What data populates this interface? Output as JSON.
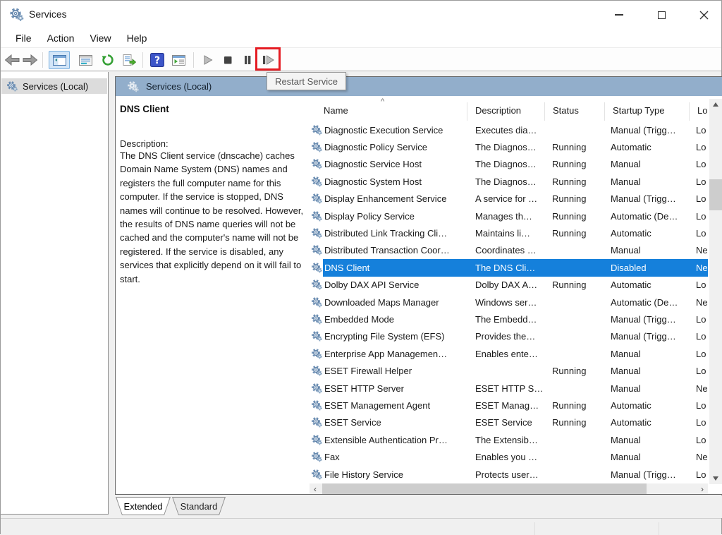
{
  "window": {
    "title": "Services"
  },
  "menu_bar": {
    "items": [
      "File",
      "Action",
      "View",
      "Help"
    ]
  },
  "toolbar": {
    "tooltip": "Restart Service"
  },
  "tree": {
    "root_label": "Services (Local)"
  },
  "band": {
    "title": "Services (Local)"
  },
  "description_pane": {
    "service_name": "DNS Client",
    "label": "Description:",
    "text": "The DNS Client service (dnscache) caches Domain Name System (DNS) names and registers the full computer name for this computer. If the service is stopped, DNS names will continue to be resolved. However, the results of DNS name queries will not be cached and the computer's name will not be registered. If the service is disabled, any services that explicitly depend on it will fail to start."
  },
  "services_table": {
    "columns": [
      "Name",
      "Description",
      "Status",
      "Startup Type",
      "Lo"
    ],
    "rows": [
      {
        "name": "Diagnostic Execution Service",
        "description": "Executes dia…",
        "status": "",
        "startup": "Manual (Trigg…",
        "logon": "Lo",
        "selected": false
      },
      {
        "name": "Diagnostic Policy Service",
        "description": "The Diagnos…",
        "status": "Running",
        "startup": "Automatic",
        "logon": "Lo",
        "selected": false
      },
      {
        "name": "Diagnostic Service Host",
        "description": "The Diagnos…",
        "status": "Running",
        "startup": "Manual",
        "logon": "Lo",
        "selected": false
      },
      {
        "name": "Diagnostic System Host",
        "description": "The Diagnos…",
        "status": "Running",
        "startup": "Manual",
        "logon": "Lo",
        "selected": false
      },
      {
        "name": "Display Enhancement Service",
        "description": "A service for …",
        "status": "Running",
        "startup": "Manual (Trigg…",
        "logon": "Lo",
        "selected": false
      },
      {
        "name": "Display Policy Service",
        "description": "Manages th…",
        "status": "Running",
        "startup": "Automatic (De…",
        "logon": "Lo",
        "selected": false
      },
      {
        "name": "Distributed Link Tracking Cli…",
        "description": "Maintains li…",
        "status": "Running",
        "startup": "Automatic",
        "logon": "Lo",
        "selected": false
      },
      {
        "name": "Distributed Transaction Coor…",
        "description": "Coordinates …",
        "status": "",
        "startup": "Manual",
        "logon": "Ne",
        "selected": false
      },
      {
        "name": "DNS Client",
        "description": "The DNS Cli…",
        "status": "",
        "startup": "Disabled",
        "logon": "Ne",
        "selected": true
      },
      {
        "name": "Dolby DAX API Service",
        "description": "Dolby DAX A…",
        "status": "Running",
        "startup": "Automatic",
        "logon": "Lo",
        "selected": false
      },
      {
        "name": "Downloaded Maps Manager",
        "description": "Windows ser…",
        "status": "",
        "startup": "Automatic (De…",
        "logon": "Ne",
        "selected": false
      },
      {
        "name": "Embedded Mode",
        "description": "The Embedd…",
        "status": "",
        "startup": "Manual (Trigg…",
        "logon": "Lo",
        "selected": false
      },
      {
        "name": "Encrypting File System (EFS)",
        "description": "Provides the…",
        "status": "",
        "startup": "Manual (Trigg…",
        "logon": "Lo",
        "selected": false
      },
      {
        "name": "Enterprise App Managemen…",
        "description": "Enables ente…",
        "status": "",
        "startup": "Manual",
        "logon": "Lo",
        "selected": false
      },
      {
        "name": "ESET Firewall Helper",
        "description": "",
        "status": "Running",
        "startup": "Manual",
        "logon": "Lo",
        "selected": false
      },
      {
        "name": "ESET HTTP Server",
        "description": "ESET HTTP S…",
        "status": "",
        "startup": "Manual",
        "logon": "Ne",
        "selected": false
      },
      {
        "name": "ESET Management Agent",
        "description": "ESET Manag…",
        "status": "Running",
        "startup": "Automatic",
        "logon": "Lo",
        "selected": false
      },
      {
        "name": "ESET Service",
        "description": "ESET Service",
        "status": "Running",
        "startup": "Automatic",
        "logon": "Lo",
        "selected": false
      },
      {
        "name": "Extensible Authentication Pr…",
        "description": "The Extensib…",
        "status": "",
        "startup": "Manual",
        "logon": "Lo",
        "selected": false
      },
      {
        "name": "Fax",
        "description": "Enables you …",
        "status": "",
        "startup": "Manual",
        "logon": "Ne",
        "selected": false
      },
      {
        "name": "File History Service",
        "description": "Protects user…",
        "status": "",
        "startup": "Manual (Trigg…",
        "logon": "Lo",
        "selected": false
      }
    ]
  },
  "tabs": {
    "items": [
      "Extended",
      "Standard"
    ],
    "active": "Extended"
  },
  "colors": {
    "selection_blue": "#1580db",
    "header_band_blue": "#92aecb",
    "highlight_red": "#e51c23",
    "tree_selected_gray": "#dcdcdc"
  }
}
